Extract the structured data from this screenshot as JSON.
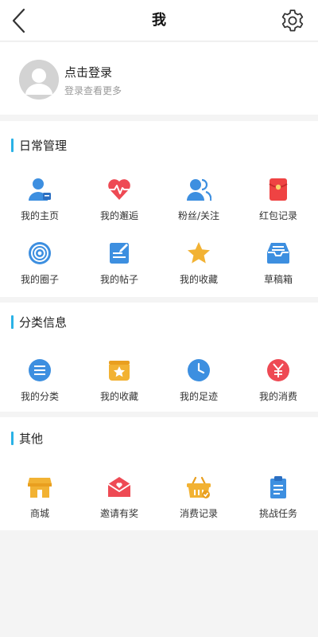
{
  "header": {
    "title": "我"
  },
  "profile": {
    "login_label": "点击登录",
    "login_hint": "登录查看更多"
  },
  "sections": [
    {
      "title": "日常管理",
      "items": [
        {
          "label": "我的主页",
          "icon": "home-user-icon",
          "color": "#3d8fe0"
        },
        {
          "label": "我的邂逅",
          "icon": "heartbeat-icon",
          "color": "#ee4a54"
        },
        {
          "label": "粉丝/关注",
          "icon": "users-icon",
          "color": "#3d8fe0"
        },
        {
          "label": "红包记录",
          "icon": "red-packet-icon",
          "color": "#ef4343"
        },
        {
          "label": "我的圈子",
          "icon": "target-circle-icon",
          "color": "#3d8fe0"
        },
        {
          "label": "我的帖子",
          "icon": "post-edit-icon",
          "color": "#3d8fe0"
        },
        {
          "label": "我的收藏",
          "icon": "star-icon",
          "color": "#f2b233"
        },
        {
          "label": "草稿箱",
          "icon": "inbox-tray-icon",
          "color": "#3d8fe0"
        }
      ]
    },
    {
      "title": "分类信息",
      "items": [
        {
          "label": "我的分类",
          "icon": "category-list-icon",
          "color": "#3d8fe0"
        },
        {
          "label": "我的收藏",
          "icon": "star-box-icon",
          "color": "#f2b233"
        },
        {
          "label": "我的足迹",
          "icon": "clock-icon",
          "color": "#3d8fe0"
        },
        {
          "label": "我的消费",
          "icon": "yen-icon",
          "color": "#ee4a54"
        }
      ]
    },
    {
      "title": "其他",
      "items": [
        {
          "label": "商城",
          "icon": "shop-icon",
          "color": "#f2b233"
        },
        {
          "label": "邀请有奖",
          "icon": "invite-envelope-icon",
          "color": "#ee4a54"
        },
        {
          "label": "消费记录",
          "icon": "shopping-basket-icon",
          "color": "#f2b233"
        },
        {
          "label": "挑战任务",
          "icon": "clipboard-task-icon",
          "color": "#3d8fe0"
        }
      ]
    }
  ]
}
